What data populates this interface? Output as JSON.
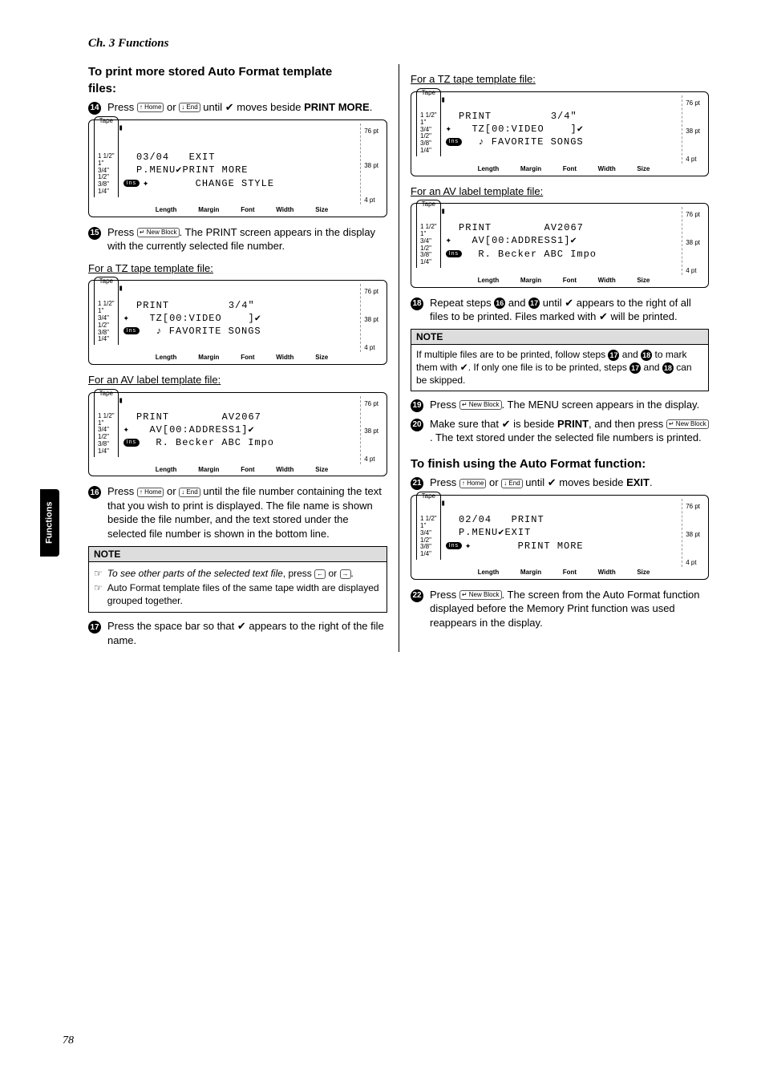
{
  "header": "Ch. 3 Functions",
  "side_tab": "Functions",
  "page_number": "78",
  "keys": {
    "home": "↑\nHome",
    "end": "↓\nEnd",
    "back": "↵\nNew\nBlock",
    "left": "←",
    "right": "→"
  },
  "lcd": {
    "tape_label": "Tape",
    "tape_sizes": [
      "1 1/2\"",
      "1\"",
      "3/4\"",
      "1/2\"",
      "3/8\"",
      "1/4\""
    ],
    "pt_sizes": [
      "76 pt",
      "38 pt",
      "4 pt"
    ],
    "ins": "Ins",
    "footer": [
      "Length",
      "Margin",
      "Font",
      "Width",
      "Size"
    ]
  },
  "left": {
    "title_line1": "To print more stored Auto Format template",
    "title_line2": "files:",
    "step14": {
      "num": "14",
      "press": "Press ",
      "or": " or ",
      "until": " until ✔ moves beside ",
      "target": "PRINT MORE",
      "period": "."
    },
    "screen14": {
      "l1": "  03/04   EXIT",
      "l2": "  P.MENU✔PRINT MORE",
      "l3": "✦       CHANGE STYLE"
    },
    "step15": {
      "num": "15",
      "press": "Press ",
      "text": ". The PRINT screen appears in the display with the currently selected file number."
    },
    "sub_tz": "For a TZ tape template file:",
    "screen_tz": {
      "l1": "  PRINT         3/4\"",
      "l2": "✦   TZ[00:VIDEO    ]✔",
      "l3": "  ♪ FAVORITE SONGS"
    },
    "sub_av": "For an AV label template file:",
    "screen_av": {
      "l1": "  PRINT        AV2067",
      "l2": "✦   AV[00:ADDRESS1]✔",
      "l3": "  R. Becker ABC Impo"
    },
    "step16": {
      "num": "16",
      "press": "Press ",
      "or": " or ",
      "text": " until the file number containing the text that you wish to print is displayed. The file name is shown beside the file number, and the text stored under the selected file number is shown in the bottom line."
    },
    "note_header": "NOTE",
    "note_item1a": "To see other parts of the selected text file",
    "note_item1b": ", press ",
    "note_item1c": " or ",
    "note_item1d": ".",
    "note_item2": "Auto Format template files of the same tape width are displayed grouped together.",
    "step17": {
      "num": "17",
      "text": "Press the space bar so that ✔ appears to the right of the file name."
    }
  },
  "right": {
    "sub_tz": "For a TZ tape template file:",
    "screen_tz_r": {
      "l1": "  PRINT         3/4\"",
      "l2": "✦   TZ[00:VIDEO    ]✔",
      "l3": "  ♪ FAVORITE SONGS"
    },
    "sub_av": "For an AV label template file:",
    "screen_av_r": {
      "l1": "  PRINT        AV2067",
      "l2": "✦   AV[00:ADDRESS1]✔",
      "l3": "  R. Becker ABC Impo"
    },
    "step18": {
      "num": "18",
      "a": "Repeat steps ",
      "b": " and ",
      "c": " until ✔ appears to the right of all files to be printed. Files marked with ✔ will be printed."
    },
    "note_header": "NOTE",
    "note_body_a": "If multiple files are to be printed, follow steps ",
    "note_body_b": " and ",
    "note_body_c": " to mark them with ✔. If only one file is to be printed, steps ",
    "note_body_d": " and ",
    "note_body_e": " can be skipped.",
    "step19": {
      "num": "19",
      "press": "Press ",
      "text": ". The MENU screen appears in the display."
    },
    "step20": {
      "num": "20",
      "a": "Make sure that ✔ is beside ",
      "b": "PRINT",
      "c": ", and then press ",
      "d": ". The text stored under the selected file numbers is printed."
    },
    "finish_title": "To finish using the Auto Format function:",
    "step21": {
      "num": "21",
      "press": "Press ",
      "or": " or ",
      "text": " until ✔ moves beside ",
      "target": "EXIT",
      "period": "."
    },
    "screen21": {
      "l1": "  02/04   PRINT",
      "l2": "  P.MENU✔EXIT",
      "l3": "✦       PRINT MORE"
    },
    "step22": {
      "num": "22",
      "press": "Press ",
      "text": ". The screen from the Auto Format function displayed before the Memory Print function was used reappears in the display."
    }
  },
  "step_refs": {
    "s16": "16",
    "s17": "17",
    "s18": "18"
  }
}
